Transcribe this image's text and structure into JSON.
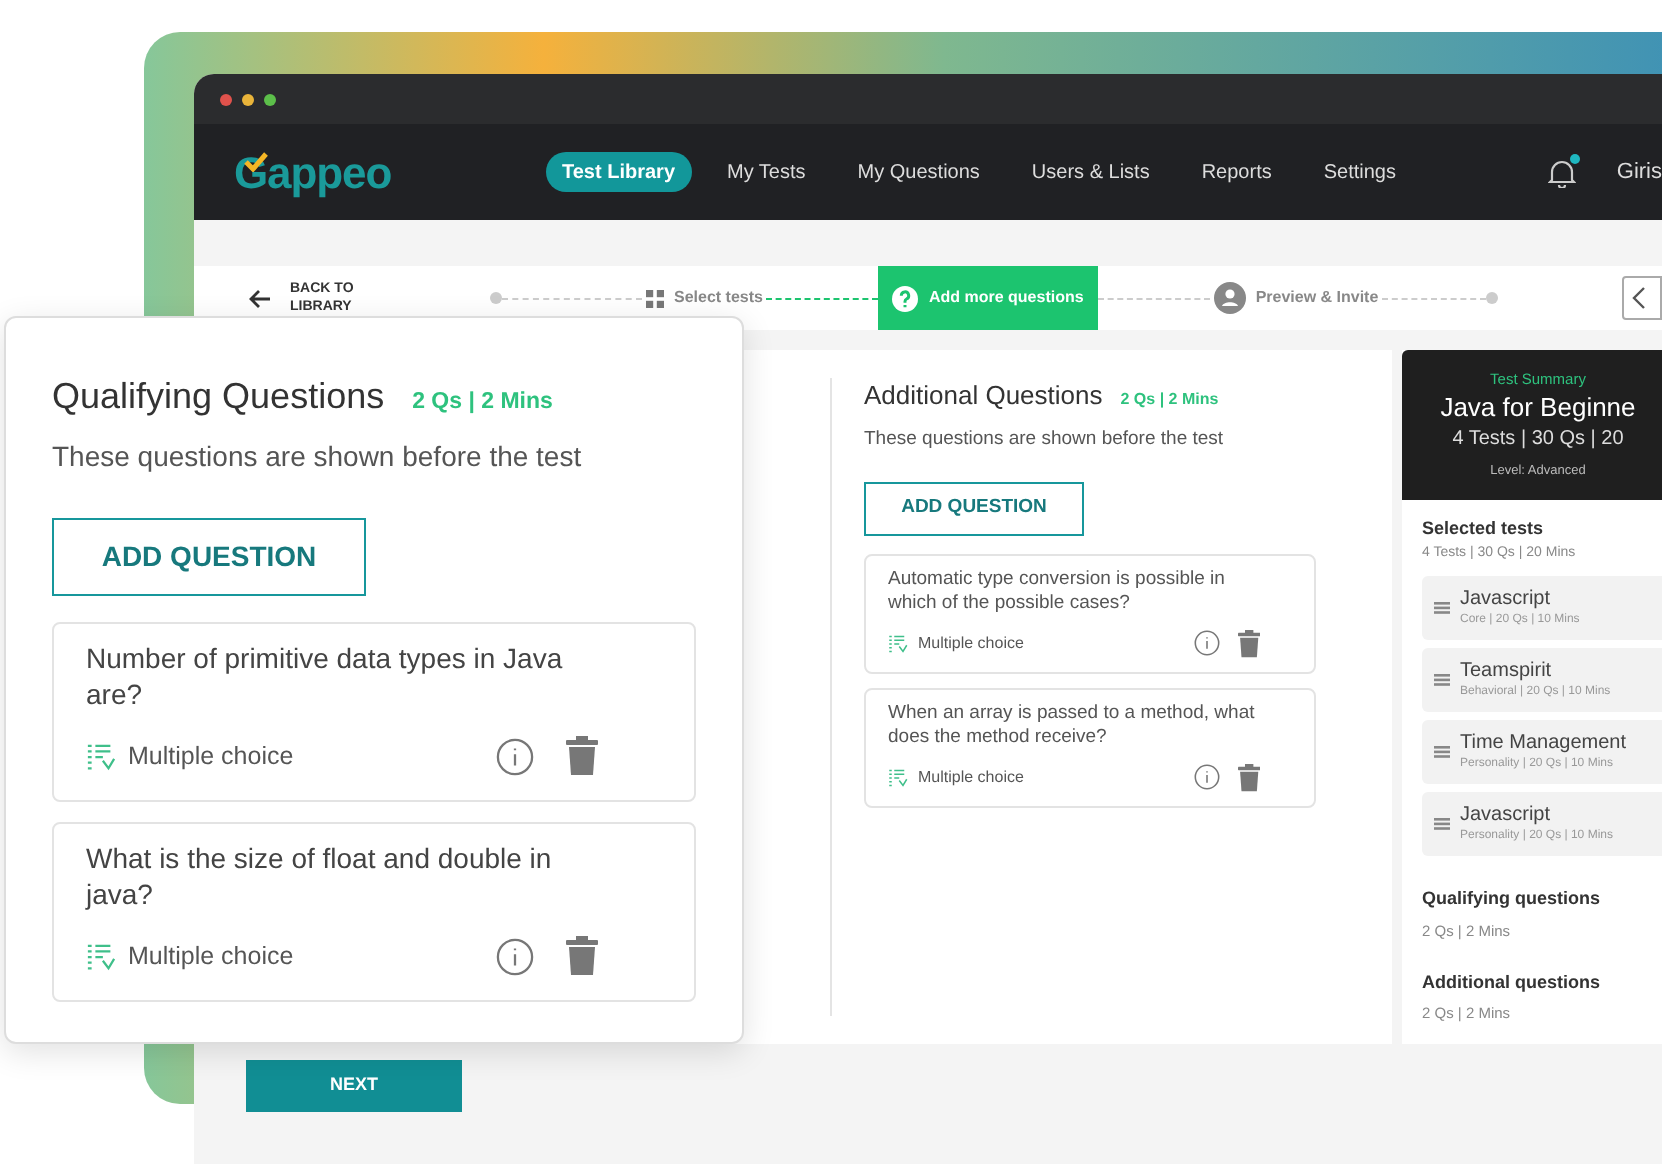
{
  "nav": {
    "logo": "Gappeo",
    "items": [
      {
        "label": "Test Library",
        "selected": true
      },
      {
        "label": "My Tests",
        "selected": false
      },
      {
        "label": "My Questions",
        "selected": false
      },
      {
        "label": "Users  & Lists",
        "selected": false
      },
      {
        "label": "Reports",
        "selected": false
      },
      {
        "label": "Settings",
        "selected": false
      }
    ],
    "has_notification": true,
    "user": "Giris"
  },
  "back_link": "BACK TO LIBRARY",
  "steps": [
    {
      "label": "Select tests",
      "kind": "grid",
      "selected": false
    },
    {
      "label": "Add more questions",
      "kind": "help",
      "selected": true
    },
    {
      "label": "Preview  & Invite",
      "kind": "person",
      "selected": false
    }
  ],
  "qualifying": {
    "title": "Qualifying Questions",
    "meta": "2 Qs | 2 Mins",
    "description": "These questions are shown before the test",
    "add_button": "ADD QUESTION",
    "questions": [
      {
        "text": "Number of primitive data types in Java are?",
        "type": "Multiple choice"
      },
      {
        "text": "What is the size of float and double in java?",
        "type": "Multiple choice"
      }
    ]
  },
  "additional": {
    "title": "Additional Questions",
    "meta": "2 Qs | 2 Mins",
    "description": "These questions are shown before the test",
    "add_button": "ADD QUESTION",
    "questions": [
      {
        "text": "Automatic type conversion is possible in which of the possible cases?",
        "type": "Multiple choice"
      },
      {
        "text": "When an array is passed to a method, what does the method receive?",
        "type": "Multiple choice"
      }
    ]
  },
  "summary": {
    "label": "Test Summary",
    "title": "Java for Beginne",
    "stats": "4 Tests | 30 Qs | 20",
    "level": "Level: Advanced",
    "selected_title": "Selected tests",
    "selected_meta": "4 Tests | 30 Qs | 20 Mins",
    "tests": [
      {
        "name": "Javascript",
        "meta": "Core | 20 Qs | 10 Mins"
      },
      {
        "name": "Teamspirit",
        "meta": "Behavioral | 20 Qs | 10 Mins"
      },
      {
        "name": "Time Management",
        "meta": "Personality | 20 Qs | 10 Mins"
      },
      {
        "name": "Javascript",
        "meta": "Personality | 20 Qs | 10 Mins"
      }
    ],
    "sections": [
      {
        "title": "Qualifying questions",
        "meta": "2 Qs | 2 Mins"
      },
      {
        "title": "Additional questions",
        "meta": "2 Qs | 2 Mins"
      }
    ]
  },
  "next_button": "NEXT"
}
